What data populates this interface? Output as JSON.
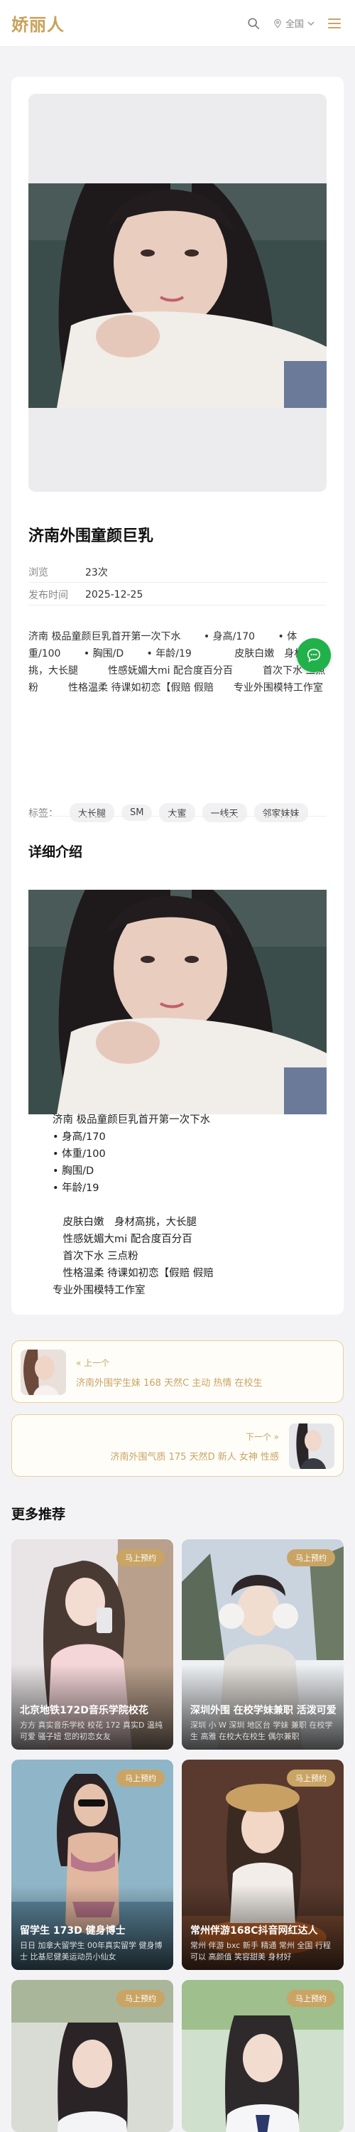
{
  "header": {
    "logo": "娇丽人",
    "search_icon": "search-icon",
    "location_icon": "map-pin-icon",
    "region": "全国",
    "menu_icon": "menu-icon"
  },
  "post": {
    "title": "济南外围童颜巨乳",
    "meta": [
      {
        "label": "浏览",
        "value": "23次"
      },
      {
        "label": "发布时间",
        "value": "2025-12-25"
      }
    ],
    "summary": "济南 极品童颜巨乳首开第一次下水　　 • 身高/170　　 • 体重/100　　 • 胸围/D　　 • 年龄/19　　　　 皮肤白嫩　身材高挑，大长腿　　　性感妩媚大mi 配合度百分百　　　首次下水 三点粉　　　性格温柔 待课如初恋【假赔 假赔　　专业外围模特工作室",
    "tags_label": "标签：",
    "tags": [
      "大长腿",
      "SM",
      "大蜜",
      "一线天",
      "邻家妹妹"
    ],
    "detail_title": "详细介绍",
    "detail_lines": "济南 极品童颜巨乳首开第一次下水\n • 身高/170\n • 体重/100\n • 胸围/D\n • 年龄/19\n\n　皮肤白嫩　身材高挑，大长腿\n　性感妩媚大mi 配合度百分百\n　首次下水 三点粉\n　性格温柔 待课如初恋【假赔 假赔\n专业外围模特工作室"
  },
  "chat_icon": "chat-bubble-icon",
  "navigation": {
    "prev_label": "« 上一个",
    "prev_title": "济南外围学生妹 168 天然C 主动 热情 在校生",
    "next_label": "下一个 »",
    "next_title": "济南外围气质 175 天然D 新人 女神 性感"
  },
  "more": {
    "title": "更多推荐",
    "book_label": "马上预约",
    "items": [
      {
        "title": "北京地铁172D音乐学院校花",
        "desc": "方方 真实音乐学校 校花 172 真实D 温纯可爱 骚子妞 您的初恋女友"
      },
      {
        "title": "深圳外围 在校学妹兼职 活泼可爱",
        "desc": "深圳 小 W 深圳 地区台 学妹 兼职 在校学生 高雅 在校大在校生 偶尔兼职"
      },
      {
        "title": "留学生 173D 健身博士",
        "desc": "日日 加拿大留学生 00年真实留学 健身博士 比基尼健美运动员小仙女"
      },
      {
        "title": "常州伴游168C抖音网红达人",
        "desc": "常州 伴游 bxc 新手 精通 常州 全国 行程 可以 高颜值 笑容甜美 身材好"
      },
      {
        "title": "",
        "desc": ""
      },
      {
        "title": "",
        "desc": ""
      }
    ]
  },
  "colors": {
    "accent": "#c9a464",
    "chat": "#21b14a"
  }
}
